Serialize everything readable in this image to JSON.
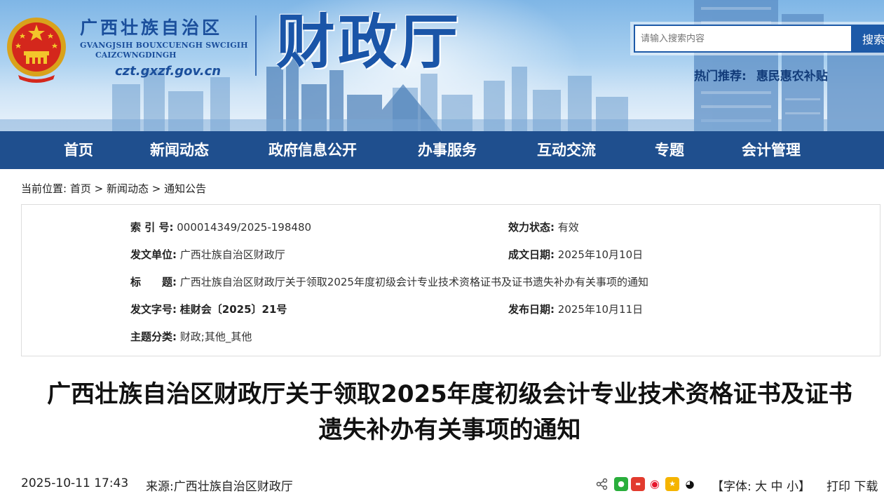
{
  "header": {
    "org_cn": "广西壮族自治区",
    "org_zh_line1": "GVANGJSIH BOUXCUENGH SWCIGIH",
    "org_zh_line2": "CAIZCWNGDINGH",
    "site_url": "czt.gxzf.gov.cn",
    "dept_title": "财政厅",
    "search_placeholder": "请输入搜索内容",
    "search_button": "搜索",
    "hot_label": "热门推荐:",
    "hot_link": "惠民惠农补贴"
  },
  "nav": [
    "首页",
    "新闻动态",
    "政府信息公开",
    "办事服务",
    "互动交流",
    "专题",
    "会计管理"
  ],
  "breadcrumb": {
    "label": "当前位置:",
    "items": [
      "首页",
      "新闻动态",
      "通知公告"
    ],
    "sep": ">"
  },
  "meta": {
    "index_label": "索 引 号:",
    "index_value": "000014349/2025-198480",
    "status_label": "效力状态:",
    "status_value": "有效",
    "issuer_label": "发文单位:",
    "issuer_value": "广西壮族自治区财政厅",
    "created_label": "成文日期:",
    "created_value": "2025年10月10日",
    "title_label": "标　　题:",
    "title_value": "广西壮族自治区财政厅关于领取2025年度初级会计专业技术资格证书及证书遗失补办有关事项的通知",
    "docno_label": "发文字号:",
    "docno_value": "桂财会〔2025〕21号",
    "published_label": "发布日期:",
    "published_value": "2025年10月11日",
    "topic_label": "主题分类:",
    "topic_value": "财政;其他_其他"
  },
  "article": {
    "title_line1": "广西壮族自治区财政厅关于领取2025年度初级会计专业技术资格证书及证书",
    "title_line2": "遗失补办有关事项的通知",
    "datetime": "2025-10-11 17:43",
    "source": "来源:广西壮族自治区财政厅"
  },
  "share_icons": [
    "share-icon",
    "wechat-icon",
    "toutiao-icon",
    "weibo-icon",
    "qzone-icon",
    "qq-icon"
  ],
  "font_size": {
    "open": "【字体:",
    "large": "大",
    "medium": "中",
    "small": "小",
    "close": "】"
  },
  "tools": {
    "print": "打印",
    "download": "下载"
  },
  "colors": {
    "nav_bg": "#1f4f8e",
    "brand_blue": "#1a55a8"
  }
}
